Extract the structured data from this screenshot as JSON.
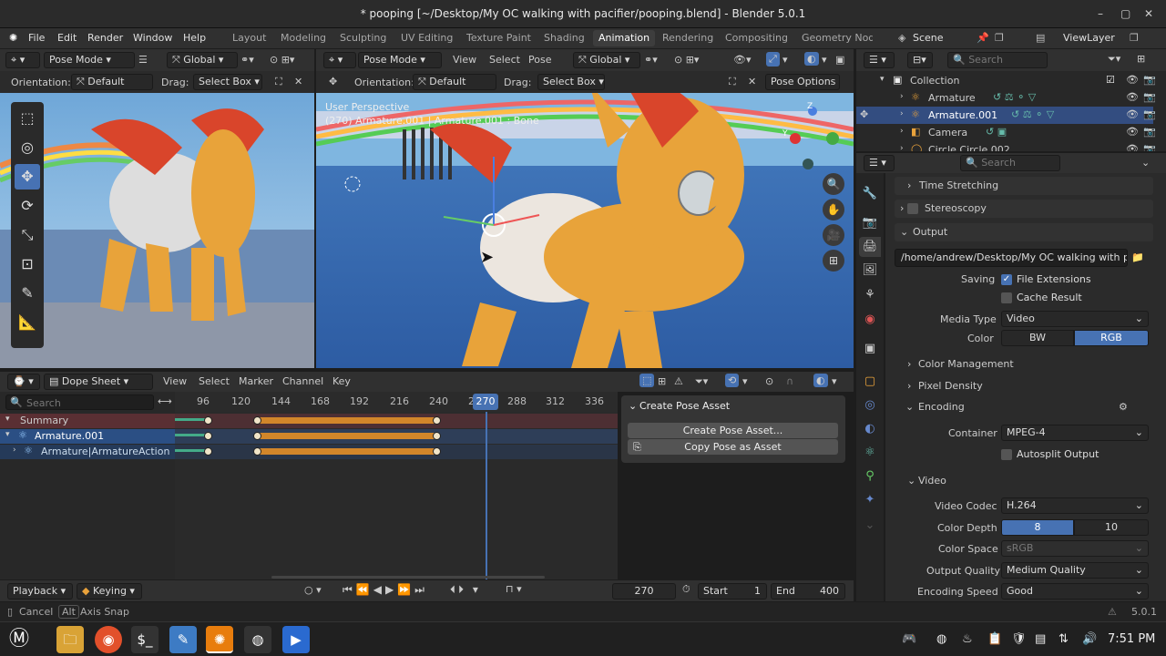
{
  "window": {
    "title": "* pooping [~/Desktop/My OC walking with pacifier/pooping.blend] - Blender 5.0.1",
    "minimize": "–",
    "maximize": "▢",
    "close": "✕"
  },
  "menu": {
    "items": [
      "File",
      "Edit",
      "Render",
      "Window",
      "Help"
    ]
  },
  "workspaces": [
    "Layout",
    "Modeling",
    "Sculpting",
    "UV Editing",
    "Texture Paint",
    "Shading",
    "Animation",
    "Rendering",
    "Compositing",
    "Geometry Node"
  ],
  "active_workspace": "Animation",
  "scene": {
    "scene_label": "Scene",
    "view_layer": "ViewLayer"
  },
  "left_viewport": {
    "mode": "Pose Mode",
    "transform": "Global",
    "orientation_label": "Orientation:",
    "orientation": "Default",
    "drag_label": "Drag:",
    "drag": "Select Box"
  },
  "main_viewport": {
    "mode": "Pose Mode",
    "view": "View",
    "select": "Select",
    "pose": "Pose",
    "transform": "Global",
    "orientation_label": "Orientation:",
    "orientation": "Default",
    "drag_label": "Drag:",
    "drag": "Select Box",
    "pose_options": "Pose Options",
    "overlay_line1": "User Perspective",
    "overlay_line2": "(270) Armature.001 | Armature.001 : Bone",
    "gizmo_z": "Z",
    "gizmo_y": "Y"
  },
  "dopesheet": {
    "editor": "Dope Sheet",
    "menus": [
      "View",
      "Select",
      "Marker",
      "Channel",
      "Key"
    ],
    "search_placeholder": "Search",
    "ticks": [
      "96",
      "120",
      "144",
      "168",
      "192",
      "216",
      "240",
      "2",
      "288",
      "312",
      "336"
    ],
    "current_frame": "270",
    "channels": [
      "Summary",
      "Armature.001",
      "Armature|ArmatureAction"
    ],
    "panel_title": "Create Pose Asset",
    "panel_buttons": [
      "Create Pose Asset...",
      "Copy Pose as Asset"
    ]
  },
  "timeline": {
    "playback": "Playback",
    "keying": "Keying",
    "frame": "270",
    "start_label": "Start",
    "start": "1",
    "end_label": "End",
    "end": "400"
  },
  "status": {
    "cancel": "Cancel",
    "alt": "Alt",
    "axis_snap": "Axis Snap",
    "version": "5.0.1"
  },
  "outliner": {
    "search_placeholder": "Search",
    "items": [
      {
        "name": "Collection",
        "depth": 0
      },
      {
        "name": "Armature",
        "depth": 1
      },
      {
        "name": "Armature.001",
        "depth": 1,
        "selected": true
      },
      {
        "name": "Camera",
        "depth": 1
      },
      {
        "name": "Circle.Circle.002",
        "depth": 1
      }
    ]
  },
  "properties": {
    "search_placeholder": "Search",
    "time_stretching": "Time Stretching",
    "stereoscopy": "Stereoscopy",
    "output": "Output",
    "output_path": "/home/andrew/Desktop/My OC walking with pa...",
    "saving_label": "Saving",
    "file_extensions": "File Extensions",
    "cache_result": "Cache Result",
    "media_type_label": "Media Type",
    "media_type": "Video",
    "color_label": "Color",
    "color_bw": "BW",
    "color_rgb": "RGB",
    "color_management": "Color Management",
    "pixel_density": "Pixel Density",
    "encoding": "Encoding",
    "container_label": "Container",
    "container": "MPEG-4",
    "autosplit": "Autosplit Output",
    "video": "Video",
    "video_codec_label": "Video Codec",
    "video_codec": "H.264",
    "color_depth_label": "Color Depth",
    "depth_8": "8",
    "depth_10": "10",
    "color_space_label": "Color Space",
    "color_space": "sRGB",
    "output_quality_label": "Output Quality",
    "output_quality": "Medium Quality",
    "encoding_speed_label": "Encoding Speed",
    "encoding_speed": "Good"
  },
  "taskbar": {
    "clock": "7:51 PM"
  },
  "colors": {
    "accent": "#4772b3",
    "key": "#d2862a",
    "playhead": "#4772b3"
  }
}
